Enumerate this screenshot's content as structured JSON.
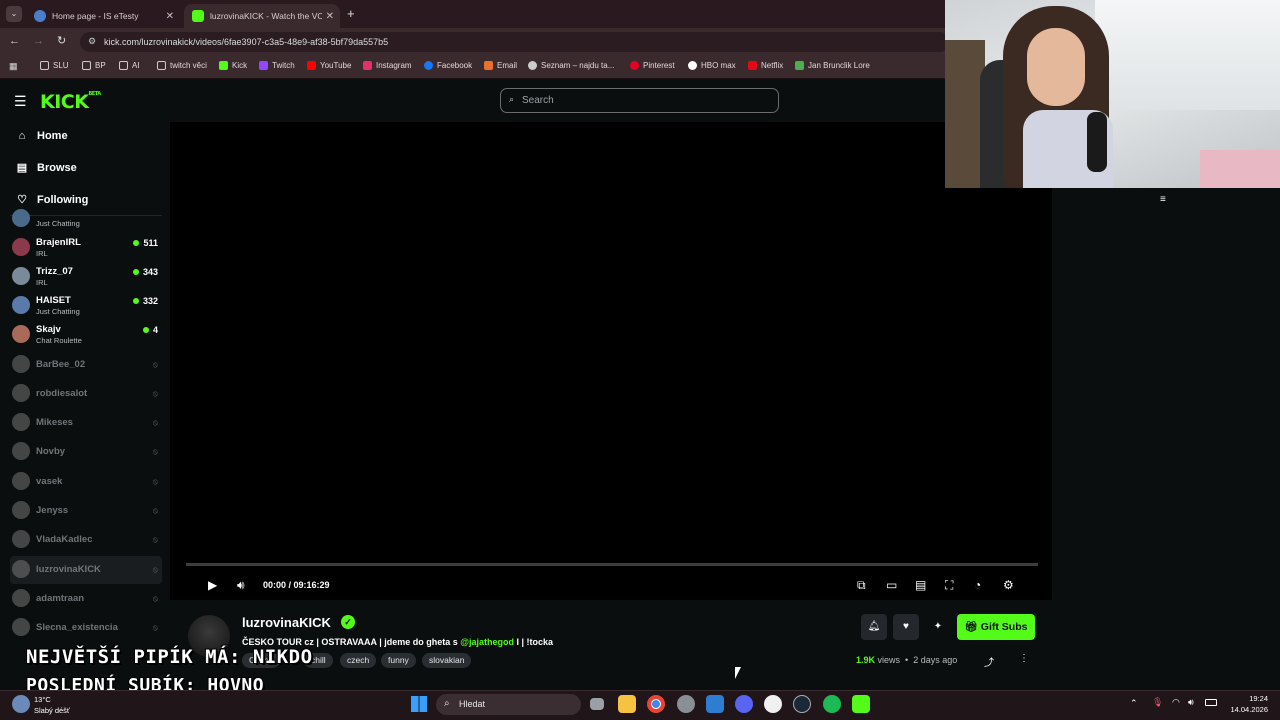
{
  "browser": {
    "tabs": [
      {
        "title": "Home page - IS eTesty",
        "active": false
      },
      {
        "title": "luzrovinaKICK - Watch the VOD",
        "active": true
      }
    ],
    "url": "kick.com/luzrovinakick/videos/6fae3907-c3a5-48e9-af38-5bf79da557b5",
    "bookmarks": [
      "SLU",
      "BP",
      "AI",
      "twitch věci",
      "Kick",
      "Twitch",
      "YouTube",
      "Instagram",
      "Facebook",
      "Email",
      "Seznam – najdu ta...",
      "Pinterest",
      "HBO max",
      "Netflix",
      "Jan Brunclik Lore"
    ]
  },
  "kick": {
    "logo": "KICK",
    "logo_badge": "BETA",
    "search_placeholder": "Search",
    "nav": [
      {
        "label": "Home",
        "icon": "home-icon"
      },
      {
        "label": "Browse",
        "icon": "browse-icon"
      },
      {
        "label": "Following",
        "icon": "heart-icon"
      }
    ],
    "following": [
      {
        "name": "",
        "category": "Just Chatting",
        "viewers": "",
        "live": true,
        "color": "#4a6a8a"
      },
      {
        "name": "BrajenIRL",
        "category": "IRL",
        "viewers": "511",
        "live": true,
        "color": "#8a3a4a"
      },
      {
        "name": "Trizz_07",
        "category": "IRL",
        "viewers": "343",
        "live": true,
        "color": "#7a8a9a"
      },
      {
        "name": "HAISET",
        "category": "Just Chatting",
        "viewers": "332",
        "live": true,
        "color": "#5a7aaa"
      },
      {
        "name": "Skajv",
        "category": "Chat Roulette",
        "viewers": "4",
        "live": true,
        "color": "#aa6a5a"
      },
      {
        "name": "BarBee_02",
        "category": "",
        "viewers": "",
        "live": false,
        "color": "#8a8a8a"
      },
      {
        "name": "robdiesalot",
        "category": "",
        "viewers": "",
        "live": false,
        "color": "#8a8a8a"
      },
      {
        "name": "Mikeses",
        "category": "",
        "viewers": "",
        "live": false,
        "color": "#8a8a8a"
      },
      {
        "name": "Novby",
        "category": "",
        "viewers": "",
        "live": false,
        "color": "#8a8a8a"
      },
      {
        "name": "vasek",
        "category": "",
        "viewers": "",
        "live": false,
        "color": "#8a8a8a"
      },
      {
        "name": "Jenyss",
        "category": "",
        "viewers": "",
        "live": false,
        "color": "#8a8a8a"
      },
      {
        "name": "VladaKadlec",
        "category": "",
        "viewers": "",
        "live": false,
        "color": "#8a8a8a"
      },
      {
        "name": "luzrovinaKICK",
        "category": "",
        "viewers": "",
        "live": false,
        "color": "#8a8a8a",
        "selected": true
      },
      {
        "name": "adamtraan",
        "category": "",
        "viewers": "",
        "live": false,
        "color": "#8a8a8a"
      },
      {
        "name": "Slecna_existencia",
        "category": "",
        "viewers": "",
        "live": false,
        "color": "#8a8a8a"
      }
    ],
    "player": {
      "time_current": "00:00",
      "time_total": "09:16:29",
      "timecode": "00:00 / 09:16:29",
      "progress": 0
    },
    "video": {
      "channel": "luzrovinaKICK",
      "title_prefix": "ČESKO TOUR cz | OSTRAVAAA | jdeme do gheta s ",
      "title_mention": "@jajathegod",
      "title_suffix": " I  | !tocka",
      "tags": [
        "Czech",
        "chill",
        "czech",
        "funny",
        "slovakian"
      ],
      "views": "1.9K",
      "views_label": "views",
      "age": "2 days ago",
      "gift_subs": "Gift Subs"
    }
  },
  "overlay": {
    "line1": "NEJVĚTŠÍ PIPÍK MÁ: NIKDO",
    "line2": "POSLEDNÍ SUBÍK: HOVNO"
  },
  "taskbar": {
    "search": "Hledat",
    "weather_temp": "13°C",
    "weather_desc": "Slabý déšť",
    "time": "19:24",
    "date": "14.04.2026"
  },
  "colors": {
    "accent": "#53fc18",
    "background": "#0b0e0f",
    "browser_chrome": "#3a2a2e"
  }
}
